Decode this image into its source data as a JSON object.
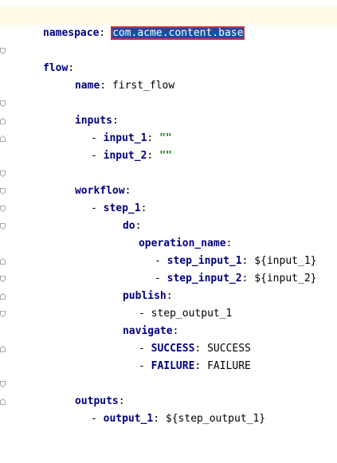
{
  "editor": {
    "lines": [
      {
        "key": "namespace",
        "sep": ": ",
        "value": "com.acme.content.base",
        "selected": true
      },
      {
        "key": "flow",
        "sep": ":"
      },
      {
        "key": "name",
        "sep": ": ",
        "value": "first_flow"
      },
      {
        "key": "inputs",
        "sep": ":"
      },
      {
        "dash": "- ",
        "key": "input_1",
        "sep": ": ",
        "str": "\"\""
      },
      {
        "dash": "- ",
        "key": "input_2",
        "sep": ": ",
        "str": "\"\""
      },
      {
        "key": "workflow",
        "sep": ":"
      },
      {
        "dash": "- ",
        "key": "step_1",
        "sep": ":"
      },
      {
        "key": "do",
        "sep": ":"
      },
      {
        "key": "operation_name",
        "sep": ":"
      },
      {
        "dash": "- ",
        "key": "step_input_1",
        "sep": ": ",
        "value": "${input_1}"
      },
      {
        "dash": "- ",
        "key": "step_input_2",
        "sep": ": ",
        "value": "${input_2}"
      },
      {
        "key": "publish",
        "sep": ":"
      },
      {
        "dash": "- ",
        "value": "step_output_1"
      },
      {
        "key": "navigate",
        "sep": ":"
      },
      {
        "dash": "- ",
        "key": "SUCCESS",
        "sep": ": ",
        "value": "SUCCESS"
      },
      {
        "dash": "- ",
        "key": "FAILURE",
        "sep": ": ",
        "value": "FAILURE"
      },
      {
        "key": "outputs",
        "sep": ":"
      },
      {
        "dash": "- ",
        "key": "output_1",
        "sep": ": ",
        "value": "${step_output_1}"
      }
    ]
  },
  "colors": {
    "key": "#000080",
    "string": "#008000",
    "selection_bg": "#1f4aa5",
    "selection_border": "#c8323c",
    "current_line": "#fffae3"
  }
}
